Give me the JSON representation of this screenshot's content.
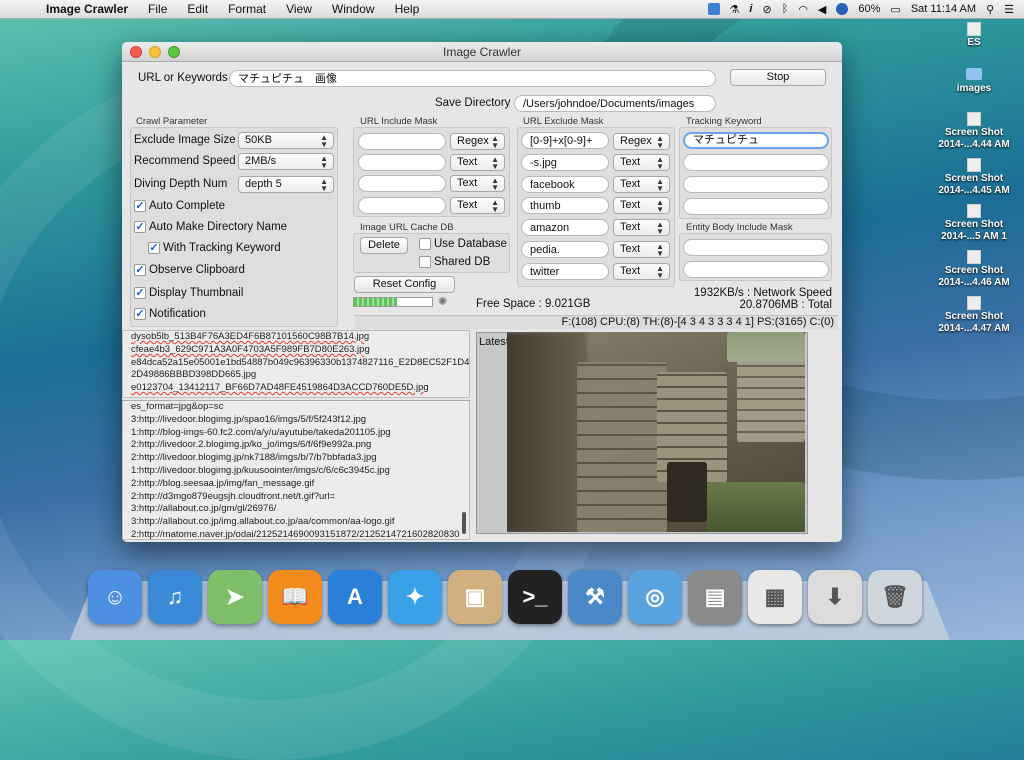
{
  "menubar": {
    "app_name": "Image Crawler",
    "menus": [
      "File",
      "Edit",
      "Format",
      "View",
      "Window",
      "Help"
    ],
    "battery": "60%",
    "clock": "Sat 11:14 AM"
  },
  "desktop": {
    "icons": [
      {
        "label": "ES",
        "kind": "file"
      },
      {
        "label": "images",
        "kind": "folder"
      },
      {
        "label": "Screen Shot\n2014-...4.44 AM",
        "line1": "Screen Shot",
        "line2": "2014-...4.44 AM",
        "kind": "file"
      },
      {
        "label": "Screen Shot\n2014-...4.45 AM",
        "line1": "Screen Shot",
        "line2": "2014-...4.45 AM",
        "kind": "file"
      },
      {
        "label": "Screen Shot\n2014-...5 AM 1",
        "line1": "Screen Shot",
        "line2": "2014-...5 AM 1",
        "kind": "file"
      },
      {
        "label": "Screen Shot\n2014-...4.46 AM",
        "line1": "Screen Shot",
        "line2": "2014-...4.46 AM",
        "kind": "file"
      },
      {
        "label": "Screen Shot\n2014-...4.47 AM",
        "line1": "Screen Shot",
        "line2": "2014-...4.47 AM",
        "kind": "file"
      }
    ]
  },
  "window": {
    "title": "Image Crawler",
    "url_label": "URL or Keywords",
    "url_value": "マチュピチュ　画像",
    "stop_label": "Stop",
    "save_dir_label": "Save Directory",
    "save_dir_value": "/Users/johndoe/Documents/images",
    "crawl": {
      "title": "Crawl Parameter",
      "exclude_label": "Exclude Image Size",
      "exclude_value": "50KB",
      "speed_label": "Recommend Speed",
      "speed_value": "2MB/s",
      "depth_label": "Diving Depth Num",
      "depth_value": "depth 5",
      "checks": [
        {
          "label": "Auto Complete",
          "checked": true
        },
        {
          "label": "Auto Make Directory Name",
          "checked": true
        },
        {
          "label": "With Tracking Keyword",
          "checked": true
        },
        {
          "label": "Observe Clipboard",
          "checked": true
        },
        {
          "label": "Display Thumbnail",
          "checked": true
        },
        {
          "label": "Notification",
          "checked": true
        }
      ]
    },
    "include": {
      "title": "URL Include Mask",
      "rows": [
        {
          "value": "",
          "mode": "Regex"
        },
        {
          "value": "",
          "mode": "Text"
        },
        {
          "value": "",
          "mode": "Text"
        },
        {
          "value": "",
          "mode": "Text"
        }
      ]
    },
    "cache": {
      "title": "Image URL Cache DB",
      "delete_label": "Delete",
      "use_db": "Use Database",
      "shared_db": "Shared DB"
    },
    "reset_label": "Reset Config",
    "exclude": {
      "title": "URL Exclude Mask",
      "rows": [
        {
          "value": "[0-9]+x[0-9]+",
          "mode": "Regex"
        },
        {
          "value": "-s.jpg",
          "mode": "Text"
        },
        {
          "value": "facebook",
          "mode": "Text"
        },
        {
          "value": "thumb",
          "mode": "Text"
        },
        {
          "value": "amazon",
          "mode": "Text"
        },
        {
          "value": "pedia.",
          "mode": "Text"
        },
        {
          "value": "twitter",
          "mode": "Text"
        }
      ]
    },
    "tracking": {
      "title": "Tracking Keyword",
      "values": [
        "マチュピチュ",
        "",
        "",
        ""
      ]
    },
    "entity": {
      "title": "Entity Body Include Mask",
      "values": [
        "",
        ""
      ]
    },
    "progress": 0.55,
    "free_space": "Free Space : 9.021GB",
    "network_speed": "1932KB/s : Network Speed",
    "total": "20.8706MB : Total",
    "stats": "F:(108) CPU:(8) TH:(8)-[4 3 4 3 3 3 4 1] PS:(3165) C:(0)",
    "log_top": [
      "dysob5lb_513B4F76A3ED4F6B87101560C98B7B14.jpg",
      "cfeae4b3_629C971A3A0F4703A5F989FB7D80E263.jpg",
      "e84dca52a15e05001e1bd54887b049c96396330b1374827116_E2D8EC52F1D4",
      "2D49886BBBD398DD665.jpg",
      "e0123704_13412117_BF66D7AD48FE4519864D3ACCD760DE5D.jpg"
    ],
    "log_top_red": [
      0,
      1,
      4
    ],
    "log_bottom": [
      "es_format=jpg&op=sc",
      "3:http://livedoor.blogimg.jp/spao16/imgs/5/f/5f243f12.jpg",
      "1:http://blog-imgs-60.fc2.com/a/y/u/ayutube/takeda201105.jpg",
      "2:http://livedoor.2.blogimg.jp/ko_jo/imgs/6/f/6f9e992a.png",
      "2:http://livedoor.blogimg.jp/nk7188/imgs/b/7/b7bbfada3.jpg",
      "1:http://livedoor.blogimg.jp/kuusoointer/imgs/c/6/c6c3945c.jpg",
      "2:http://blog.seesaa.jp/img/fan_message.gif",
      "2:http://d3mgo879eugsjh.cloudfront.net/t.gif?url=",
      "3:http://allabout.co.jp/gm/gl/26976/",
      "3:http://allabout.co.jp/img.allabout.co.jp/aa/common/aa-logo.gif",
      "2:http://matome.naver.jp/odai/2125214690093151872/2125214721602820830"
    ],
    "latest_label": "Latest"
  },
  "dock": {
    "apps": [
      {
        "name": "finder-icon",
        "color": "#4d8fe0",
        "glyph": "☺"
      },
      {
        "name": "itunes-icon",
        "color": "#3a8ad8",
        "glyph": "♫"
      },
      {
        "name": "maps-icon",
        "color": "#7fbf6a",
        "glyph": "➤"
      },
      {
        "name": "ibooks-icon",
        "color": "#f28c1c",
        "glyph": "📖"
      },
      {
        "name": "app-store-icon",
        "color": "#2a7fd8",
        "glyph": "A"
      },
      {
        "name": "safari-icon",
        "color": "#3aa0e8",
        "glyph": "✦"
      },
      {
        "name": "preview-icon",
        "color": "#d0b080",
        "glyph": "▣"
      },
      {
        "name": "terminal-icon",
        "color": "#222222",
        "glyph": ">_"
      },
      {
        "name": "xcode-icon",
        "color": "#4a88c8",
        "glyph": "⚒"
      },
      {
        "name": "network-icon",
        "color": "#5ba3e0",
        "glyph": "◎"
      },
      {
        "name": "disk-utility-icon",
        "color": "#8a8a8a",
        "glyph": "▤"
      },
      {
        "name": "document-icon",
        "color": "#e8e8e8",
        "glyph": "▦"
      },
      {
        "name": "downloads-icon",
        "color": "#dcdcdc",
        "glyph": "⬇"
      },
      {
        "name": "trash-icon",
        "color": "#cfd6dc",
        "glyph": "🗑"
      }
    ]
  }
}
